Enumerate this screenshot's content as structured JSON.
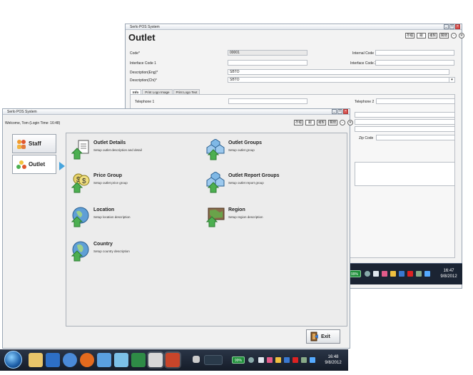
{
  "back_window": {
    "titlebar": "Serlo POS System",
    "title": "Outlet",
    "toolbar": [
      "存檔",
      "刪",
      "複製",
      "關閉"
    ],
    "fields": {
      "code_label": "Code*",
      "code_value": "00001",
      "interface_code1_label": "Interface Code 1",
      "desc_eng_label": "Description(Eng)*",
      "desc_eng_value": "SBTO",
      "desc_chi_label": "Description(Chi)*",
      "desc_chi_value": "SBTO",
      "internal_code_label": "Internal Code",
      "interface_code2_label": "Interface Code 2",
      "telephone1_label": "Telephone 1",
      "telephone2_label": "Telephone 2",
      "zipcode_label": "Zip Code"
    },
    "tabs": [
      "Info",
      "Print Logo Image",
      "Print Logo Text"
    ]
  },
  "back_taskbar": {
    "battery": "99%",
    "time": "16:47",
    "date": "9/8/2012"
  },
  "front_window": {
    "titlebar": "Serlo POS System",
    "welcome": "Welcome, Tom (Login Time: 16:48)",
    "toolbar": [
      "存檔",
      "刪",
      "複製",
      "關閉"
    ],
    "sidebar": [
      {
        "label": "Staff"
      },
      {
        "label": "Outlet"
      }
    ],
    "menu": [
      {
        "title": "Outlet Details",
        "desc": "Setup outlet description and detail"
      },
      {
        "title": "Outlet Groups",
        "desc": "Setup outlet group"
      },
      {
        "title": "Price Group",
        "desc": "Setup outlet price group"
      },
      {
        "title": "Outlet Report Groups",
        "desc": "Setup outlet report group"
      },
      {
        "title": "Location",
        "desc": "Setup location description"
      },
      {
        "title": "Region",
        "desc": "Setup region description"
      },
      {
        "title": "Country",
        "desc": "Setup country description"
      }
    ],
    "exit_label": "Exit"
  },
  "taskbar": {
    "battery": "99%",
    "time": "16:48",
    "date": "9/8/2012",
    "colors": {
      "bar": "#1b2433",
      "battery": "#1f8f3a",
      "accent": "#47a4dd"
    }
  }
}
